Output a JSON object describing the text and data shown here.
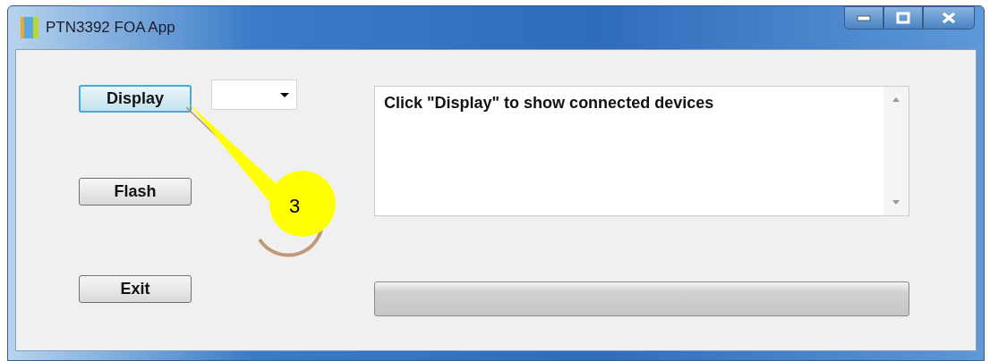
{
  "window": {
    "title": "PTN3392 FOA App"
  },
  "buttons": [
    {
      "label": "Display",
      "focused": true
    },
    {
      "label": "Flash",
      "focused": false
    },
    {
      "label": "Exit",
      "focused": false
    }
  ],
  "output": {
    "text": "Click \"Display\" to show connected devices"
  },
  "progress": {
    "level": 0
  },
  "callout": {
    "label": "3"
  }
}
